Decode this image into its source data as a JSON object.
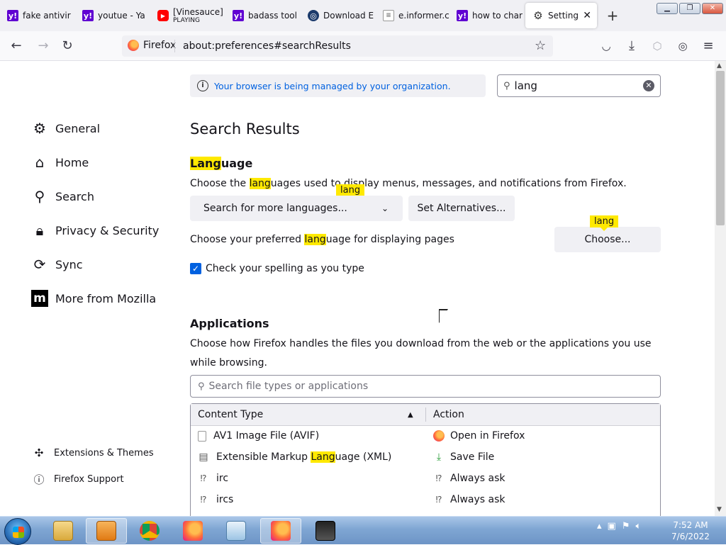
{
  "tabs": [
    {
      "title": "fake antivir",
      "icon": "yahoo-icon"
    },
    {
      "title": "youtue - Ya",
      "icon": "yahoo-icon"
    },
    {
      "title": "[Vinesauce]",
      "sub": "PLAYING",
      "icon": "youtube-icon"
    },
    {
      "title": "badass tool",
      "icon": "yahoo-icon"
    },
    {
      "title": "Download E",
      "icon": "download-site-icon"
    },
    {
      "title": "e.informer.c",
      "icon": "page-icon"
    },
    {
      "title": "how to char",
      "icon": "yahoo-icon"
    },
    {
      "title": "Settings",
      "icon": "gear-icon",
      "active": true
    }
  ],
  "nav": {
    "identity": "Firefox",
    "url": "about:preferences#searchResults"
  },
  "sidebar": {
    "items": [
      {
        "label": "General",
        "icon": "gear-icon"
      },
      {
        "label": "Home",
        "icon": "home-icon"
      },
      {
        "label": "Search",
        "icon": "search-icon"
      },
      {
        "label": "Privacy & Security",
        "icon": "lock-icon"
      },
      {
        "label": "Sync",
        "icon": "sync-icon"
      },
      {
        "label": "More from Mozilla",
        "icon": "mozilla-icon"
      }
    ],
    "footer": [
      {
        "label": "Extensions & Themes",
        "icon": "puzzle-icon"
      },
      {
        "label": "Firefox Support",
        "icon": "help-icon"
      }
    ]
  },
  "managed_notice": "Your browser is being managed by your organization.",
  "search": {
    "value": "lang"
  },
  "results_title": "Search Results",
  "language": {
    "heading_hl": "Lang",
    "heading_rest": "uage",
    "desc_pre": "Choose the ",
    "desc_hl": "lang",
    "desc_mid": "uages used to ",
    "desc_hidden": "display",
    "desc_post": " menus, messages, and notifications from Firefox.",
    "select_label": "Search for more languages...",
    "alt_button": "Set Alternatives...",
    "pref_pre": "Choose your preferred ",
    "pref_hl": "lang",
    "pref_post": "uage for displaying pages",
    "choose_button": "Choose...",
    "tooltip": "lang",
    "spell_label": "Check your spelling as you type",
    "spell_checked": true
  },
  "applications": {
    "heading": "Applications",
    "desc": "Choose how Firefox handles the files you download from the web or the applications you use while browsing.",
    "search_placeholder": "Search file types or applications",
    "col_type": "Content Type",
    "col_action": "Action",
    "rows": [
      {
        "type": "AV1 Image File (AVIF)",
        "action": "Open in Firefox",
        "type_icon": "file-icon",
        "action_icon": "firefox-icon"
      },
      {
        "type_pre": "Extensible Markup ",
        "type_hl": "Lang",
        "type_post": "uage (XML)",
        "action": "Save File",
        "type_icon": "document-icon",
        "action_icon": "save-icon"
      },
      {
        "type": "irc",
        "action": "Always ask",
        "type_icon": "ask-icon",
        "action_icon": "ask-icon"
      },
      {
        "type": "ircs",
        "action": "Always ask",
        "type_icon": "ask-icon",
        "action_icon": "ask-icon"
      }
    ]
  },
  "taskbar": {
    "time": "7:52 AM",
    "date": "7/6/2022"
  }
}
